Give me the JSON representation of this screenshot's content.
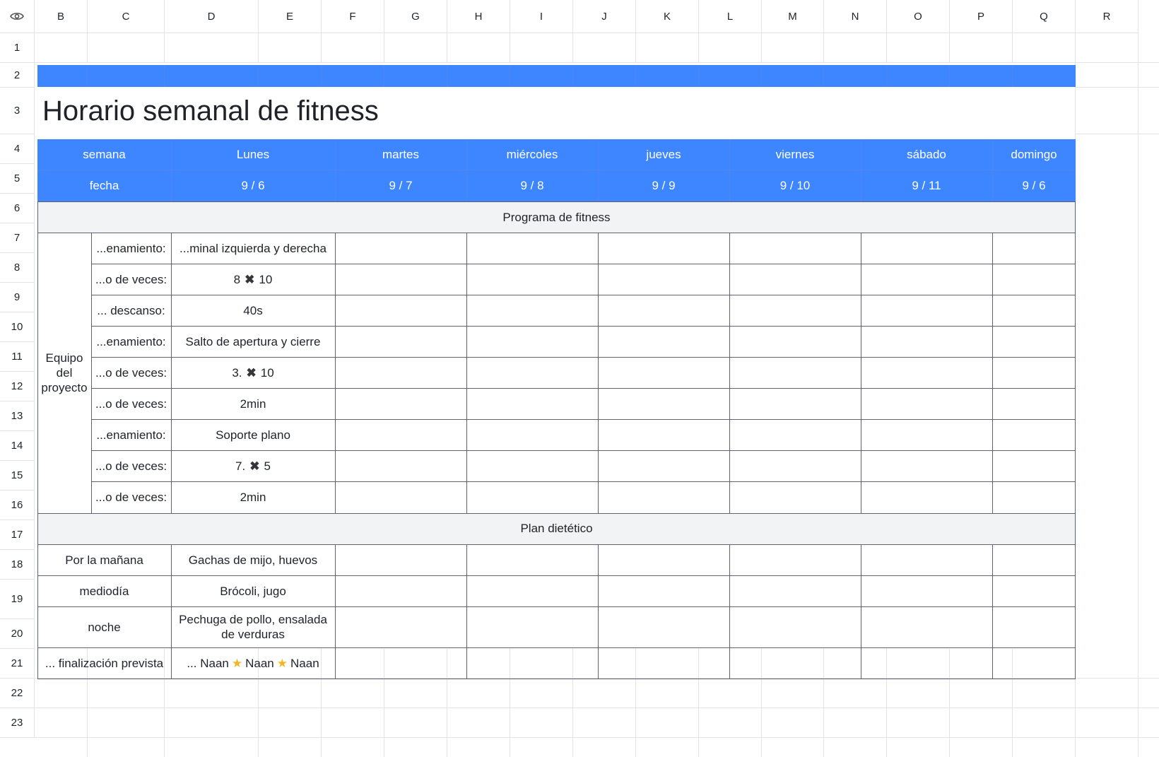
{
  "sheet": {
    "columns": [
      "B",
      "C",
      "D",
      "E",
      "F",
      "G",
      "H",
      "I",
      "J",
      "K",
      "L",
      "M",
      "N",
      "O",
      "P",
      "Q",
      "R"
    ],
    "rows": [
      "1",
      "2",
      "3",
      "4",
      "5",
      "6",
      "7",
      "8",
      "9",
      "10",
      "11",
      "12",
      "13",
      "14",
      "15",
      "16",
      "17",
      "18",
      "19",
      "20",
      "21",
      "22",
      "23"
    ]
  },
  "title": "Horario semanal de fitness",
  "header": {
    "week_label": "semana",
    "date_label": "fecha",
    "days": [
      "Lunes",
      "martes",
      "miércoles",
      "jueves",
      "viernes",
      "sábado",
      "domingo"
    ],
    "dates": [
      "9 / 6",
      "9 / 7",
      "9 / 8",
      "9 / 9",
      "9 / 10",
      "9 / 11",
      "9 / 6"
    ]
  },
  "fitness": {
    "section": "Programa de fitness",
    "group": "Equipo del proyecto",
    "rows": [
      {
        "label": "...enamiento:",
        "mon": "...minal izquierda y derecha"
      },
      {
        "label": "...o de veces:",
        "mon_a": "8",
        "mon_b": "10"
      },
      {
        "label": "... descanso:",
        "mon": "40s"
      },
      {
        "label": "...enamiento:",
        "mon": "Salto de apertura y cierre"
      },
      {
        "label": "...o de veces:",
        "mon_a": "3.",
        "mon_b": "10"
      },
      {
        "label": "...o de veces:",
        "mon": "2min"
      },
      {
        "label": "...enamiento:",
        "mon": "Soporte plano"
      },
      {
        "label": "...o de veces:",
        "mon_a": "7.",
        "mon_b": "5"
      },
      {
        "label": "...o de veces:",
        "mon": "2min"
      }
    ]
  },
  "diet": {
    "section": "Plan dietético",
    "rows": [
      {
        "label": "Por la mañana",
        "mon": "Gachas de mijo, huevos"
      },
      {
        "label": "mediodía",
        "mon": "Brócoli, jugo"
      },
      {
        "label": "noche",
        "mon": "Pechuga de pollo, ensalada de verduras"
      },
      {
        "label": "... finalización prevista",
        "mon_a": "... Naan",
        "mon_b": "Naan",
        "mon_c": "Naan"
      }
    ]
  },
  "icons": {
    "visibility": "eye-icon",
    "times": "cross-icon",
    "star": "star-icon"
  },
  "colors": {
    "accent": "#3d86ff",
    "section_bg": "#f1f3f5",
    "border": "#5c6270"
  }
}
